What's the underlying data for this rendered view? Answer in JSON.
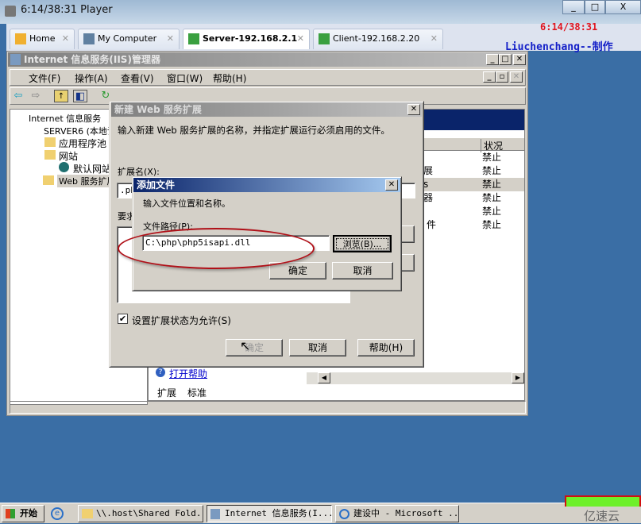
{
  "player": {
    "title": "6:14/38:31 Player",
    "controls": [
      "_",
      "□",
      "X"
    ]
  },
  "tabs": [
    {
      "label": "Home",
      "active": false
    },
    {
      "label": "My Computer",
      "active": false
    },
    {
      "label": "Server-192.168.2.1",
      "active": true
    },
    {
      "label": "Client-192.168.2.20",
      "active": false
    }
  ],
  "overlay": {
    "time": "6:14/38:31",
    "author": "Liuchenchang--制作",
    "time_color": "#e0141e",
    "author_color": "#1420c8"
  },
  "iis": {
    "title": "Internet 信息服务(IIS)管理器",
    "menu": [
      "文件(F)",
      "操作(A)",
      "查看(V)",
      "窗口(W)",
      "帮助(H)"
    ],
    "tree": [
      "Internet 信息服务",
      "SERVER6 (本地计",
      "应用程序池",
      "网站",
      "默认网站",
      "Web 服务扩展"
    ],
    "list": {
      "status_header": "状况",
      "rows": [
        {
          "name": "",
          "status": "禁止"
        },
        {
          "name": "展",
          "status": "禁止"
        },
        {
          "name": "s",
          "status": "禁止",
          "selected": true
        },
        {
          "name": "器",
          "status": "禁止"
        },
        {
          "name": "",
          "status": "禁止"
        },
        {
          "name": "件",
          "status": "禁止"
        }
      ]
    },
    "help_link": "打开帮助",
    "bottom_tabs": [
      "扩展",
      "标准"
    ]
  },
  "new_ext_dialog": {
    "title": "新建 Web 服务扩展",
    "instruction": "输入新建 Web 服务扩展的名称，并指定扩展运行必须启用的文件。",
    "ext_name_label": "扩展名(X):",
    "ext_name_value": ".ph",
    "required_label": "要求",
    "checkbox_label": "设置扩展状态为允许(S)",
    "checkbox_checked": true,
    "ok": "确定",
    "cancel": "取消",
    "help": "帮助(H)"
  },
  "add_file_dialog": {
    "title": "添加文件",
    "instruction": "输入文件位置和名称。",
    "path_label": "文件路径(P):",
    "path_value": "C:\\php\\php5isapi.dll",
    "browse": "浏览(B)...",
    "ok": "确定",
    "cancel": "取消"
  },
  "taskbar": {
    "start": "开始",
    "items": [
      {
        "label": "\\\\.host\\Shared Fold...",
        "active": false
      },
      {
        "label": "Internet 信息服务(I...",
        "active": true
      },
      {
        "label": "建设中 - Microsoft ...",
        "active": false
      }
    ]
  },
  "watermark": "亿速云"
}
